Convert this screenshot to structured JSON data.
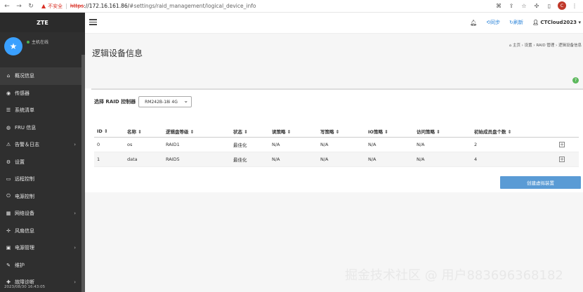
{
  "browser": {
    "insecure_label": "不安全",
    "url_scheme": "https",
    "url_host": "://172.16.161.86/",
    "url_path": "#settings/raid_management/logical_device_info",
    "avatar_letter": "C"
  },
  "sidebar": {
    "brand": "ZTE",
    "host_status": "主机在线",
    "items": [
      {
        "label": "概况信息",
        "icon": "home-icon",
        "glyph": "⌂",
        "active": true
      },
      {
        "label": "传感器",
        "icon": "sensor-icon",
        "glyph": "◉"
      },
      {
        "label": "系统清单",
        "icon": "list-icon",
        "glyph": "☰"
      },
      {
        "label": "FRU 信息",
        "icon": "fru-icon",
        "glyph": "◍"
      },
      {
        "label": "告警＆日志",
        "icon": "alarm-icon",
        "glyph": "⚠",
        "arrow": true
      },
      {
        "label": "设置",
        "icon": "gear-icon",
        "glyph": "⚙"
      },
      {
        "label": "远程控制",
        "icon": "monitor-icon",
        "glyph": "▭"
      },
      {
        "label": "电源控制",
        "icon": "power-icon",
        "glyph": "⏻"
      },
      {
        "label": "网络设备",
        "icon": "network-icon",
        "glyph": "▦",
        "arrow": true
      },
      {
        "label": "风扇信息",
        "icon": "fan-icon",
        "glyph": "✢"
      },
      {
        "label": "电源管理",
        "icon": "battery-icon",
        "glyph": "▣",
        "arrow": true
      },
      {
        "label": "维护",
        "icon": "wrench-icon",
        "glyph": "✎"
      },
      {
        "label": "故障诊断",
        "icon": "diagnose-icon",
        "glyph": "✚",
        "arrow": true
      }
    ],
    "timestamp": "2023/08/30 16:43:05"
  },
  "header": {
    "sync_label": "同步",
    "refresh_label": "刷新",
    "user": "CTCloud2023"
  },
  "page": {
    "title": "逻辑设备信息",
    "breadcrumb": "主页 › 设置 › RAID 管理 › 逻辑设备信息"
  },
  "controller": {
    "label": "选择 RAID 控制器",
    "selected": "RM242B-18i 4G"
  },
  "table": {
    "headers": [
      "ID",
      "名称",
      "逻辑盘等级",
      "状态",
      "读策略",
      "写策略",
      "IO策略",
      "访问策略",
      "初始成员盘个数"
    ],
    "rows": [
      [
        "0",
        "os",
        "RAID1",
        "最佳化",
        "N/A",
        "N/A",
        "N/A",
        "N/A",
        "2"
      ],
      [
        "1",
        "data",
        "RAID5",
        "最佳化",
        "N/A",
        "N/A",
        "N/A",
        "N/A",
        "4"
      ]
    ]
  },
  "create_button": "创建虚拟装置",
  "watermark": "掘金技术社区 @ 用户883696368182"
}
